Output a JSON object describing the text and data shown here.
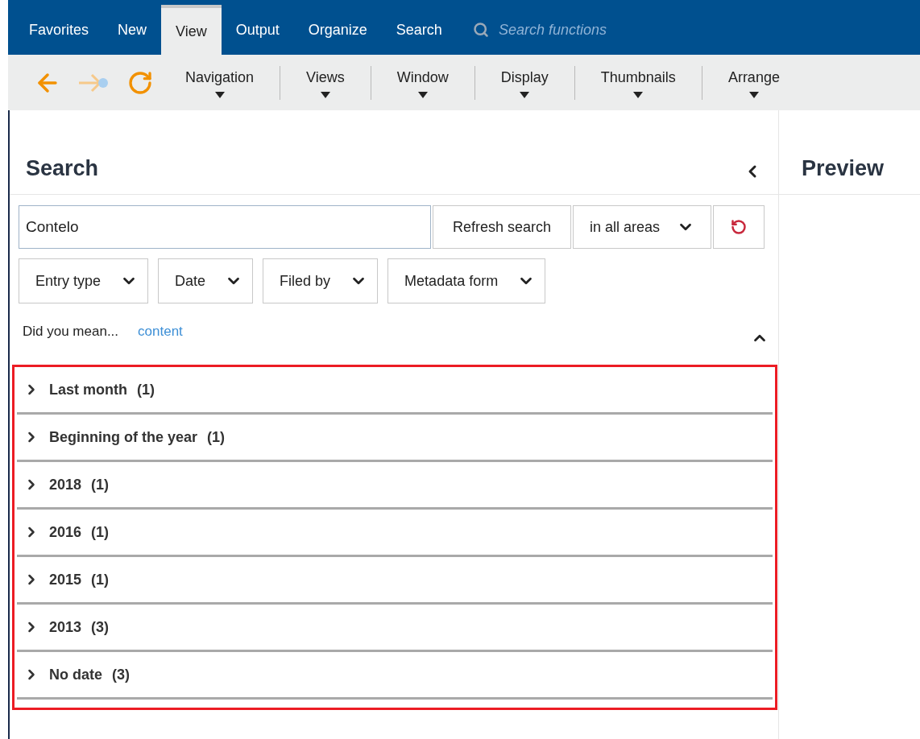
{
  "menu_tabs": [
    {
      "label": "Favorites",
      "selected": false
    },
    {
      "label": "New",
      "selected": false
    },
    {
      "label": "View",
      "selected": true
    },
    {
      "label": "Output",
      "selected": false
    },
    {
      "label": "Organize",
      "selected": false
    },
    {
      "label": "Search",
      "selected": false
    }
  ],
  "function_search": {
    "placeholder": "Search functions"
  },
  "toolbar": {
    "nav_buttons": [
      {
        "kind": "back",
        "disabled": false
      },
      {
        "kind": "forward",
        "disabled": true
      },
      {
        "kind": "refresh",
        "disabled": false
      }
    ],
    "menus": [
      "Navigation",
      "Views",
      "Window",
      "Display",
      "Thumbnails",
      "Arrange"
    ]
  },
  "search_panel": {
    "title": "Search",
    "query": "Contelo",
    "refresh_button": "Refresh search",
    "scope": "in all areas",
    "filters": [
      "Entry type",
      "Date",
      "Filed by",
      "Metadata form"
    ],
    "suggestion": {
      "prompt": "Did you mean...",
      "link": "content"
    },
    "groups": [
      {
        "label": "Last month",
        "count": "(1)",
        "expanded": false
      },
      {
        "label": "Beginning of the year",
        "count": "(1)",
        "expanded": false
      },
      {
        "label": "2018",
        "count": "(1)",
        "expanded": false
      },
      {
        "label": "2016",
        "count": "(1)",
        "expanded": false
      },
      {
        "label": "2015",
        "count": "(1)",
        "expanded": false
      },
      {
        "label": "2013",
        "count": "(3)",
        "expanded": false
      },
      {
        "label": "No date",
        "count": "(3)",
        "expanded": false
      }
    ]
  },
  "preview_panel": {
    "title": "Preview"
  }
}
